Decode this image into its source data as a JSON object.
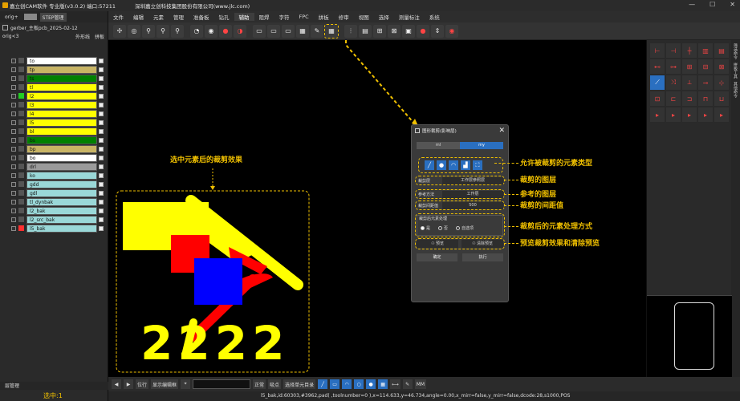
{
  "window": {
    "title": "嘉立创CAM软件 专业版(v3.0.2) 端口:57211",
    "company": "深圳嘉立创科技集团股份有限公司(www.jlc.com)",
    "controls": [
      "—",
      "☐",
      "✕"
    ]
  },
  "menu": [
    "文件",
    "编辑",
    "元素",
    "管理",
    "准备板",
    "钻孔",
    "辅助",
    "阻焊",
    "字符",
    "FPC",
    "拼板",
    "修审",
    "视图",
    "选择",
    "测量标注",
    "系统"
  ],
  "menu_active_index": 6,
  "left_panel": {
    "tabs": [
      "orig+",
      "STEP管理"
    ],
    "job": "gerber_主板pcb_2025-02-12",
    "step": "orig<3",
    "filters": [
      "外形线",
      "拼板"
    ],
    "layers": [
      {
        "name": "to",
        "color": "#ffffff",
        "sw": "#555555"
      },
      {
        "name": "tp",
        "color": "#c8b464",
        "sw": "#555555"
      },
      {
        "name": "ts",
        "color": "#008000",
        "sw": "#555555"
      },
      {
        "name": "tl",
        "color": "#ffff00",
        "sw": "#555555"
      },
      {
        "name": "l2",
        "color": "#ffff00",
        "sw": "#22cc22"
      },
      {
        "name": "l3",
        "color": "#ffff00",
        "sw": "#555555"
      },
      {
        "name": "l4",
        "color": "#ffff00",
        "sw": "#555555"
      },
      {
        "name": "l5",
        "color": "#ffff00",
        "sw": "#555555"
      },
      {
        "name": "bl",
        "color": "#ffff00",
        "sw": "#555555"
      },
      {
        "name": "bs",
        "color": "#008000",
        "sw": "#555555"
      },
      {
        "name": "bp",
        "color": "#c8b464",
        "sw": "#555555"
      },
      {
        "name": "bo",
        "color": "#ffffff",
        "sw": "#555555"
      },
      {
        "name": "drl",
        "color": "#9a9a9a",
        "sw": "#555555"
      },
      {
        "name": "ko",
        "color": "#9ad8d8",
        "sw": "#555555"
      },
      {
        "name": "gdd",
        "color": "#9ad8d8",
        "sw": "#555555"
      },
      {
        "name": "gdl",
        "color": "#9ad8d8",
        "sw": "#555555"
      },
      {
        "name": "tl_dynbak",
        "color": "#9ad8d8",
        "sw": "#555555"
      },
      {
        "name": "l2_bak",
        "color": "#9ad8d8",
        "sw": "#555555"
      },
      {
        "name": "l2_src_bak",
        "color": "#9ad8d8",
        "sw": "#555555"
      },
      {
        "name": "l5_bak",
        "color": "#9ad8d8",
        "sw": "#ff3030"
      }
    ],
    "footer": "层管理",
    "status": "选中:1"
  },
  "dialog": {
    "title": "图形裁剪(影响层)",
    "close": "✕",
    "segments": [
      "ml",
      "my"
    ],
    "segment_active": 1,
    "types": [
      "╱",
      "●",
      "◠",
      "▟",
      "⛶"
    ],
    "clip_layer_label": "裁剪层",
    "clip_layer_value": "工作层参照层",
    "ref_label": "参考方法",
    "ref_value": "工作层",
    "gap_label": "裁剪间距值",
    "gap_value": "500",
    "group_title": "裁剪后元素处理",
    "radio_options": [
      "是",
      "否",
      "自选项"
    ],
    "radio_selected": 0,
    "preview_btn": "☉ 预览",
    "clear_preview_btn": "☉ 清除预览",
    "ok": "确定",
    "apply": "执行"
  },
  "annotations": {
    "left_label": "选中元素后的裁剪效果",
    "a1": "允许被裁剪的元素类型",
    "a2": "裁剪的图层",
    "a3": "参考的图层",
    "a4": "裁剪的间距值",
    "a5": "裁剪后的元素处理方式",
    "a6": "预览裁剪效果和清除预览"
  },
  "canvas_text": "2222",
  "bottom_bar": {
    "mode": "位行",
    "view_btn": "显示编辑框",
    "select_mode": "正常",
    "snap": "吸点",
    "select_ref": "选择单元目录",
    "unit": "MM"
  },
  "status_line": "l5_bak,id:60303,#3962,pad( ,toolnumber=0 ),x=114.633,y=46.734,angle=0.00,x_mirr=false,y_mirr=false,dcode:28,s1000,POS",
  "right_panel": {
    "side_labels": [
      "筛选命令",
      "拼板工具",
      "其他命令"
    ]
  },
  "colors": {
    "accent": "#2a6fc0",
    "annotation": "#f0c000",
    "copper": "#ffff00",
    "clip_red": "#ff0000",
    "pad_blue": "#0000ff"
  }
}
